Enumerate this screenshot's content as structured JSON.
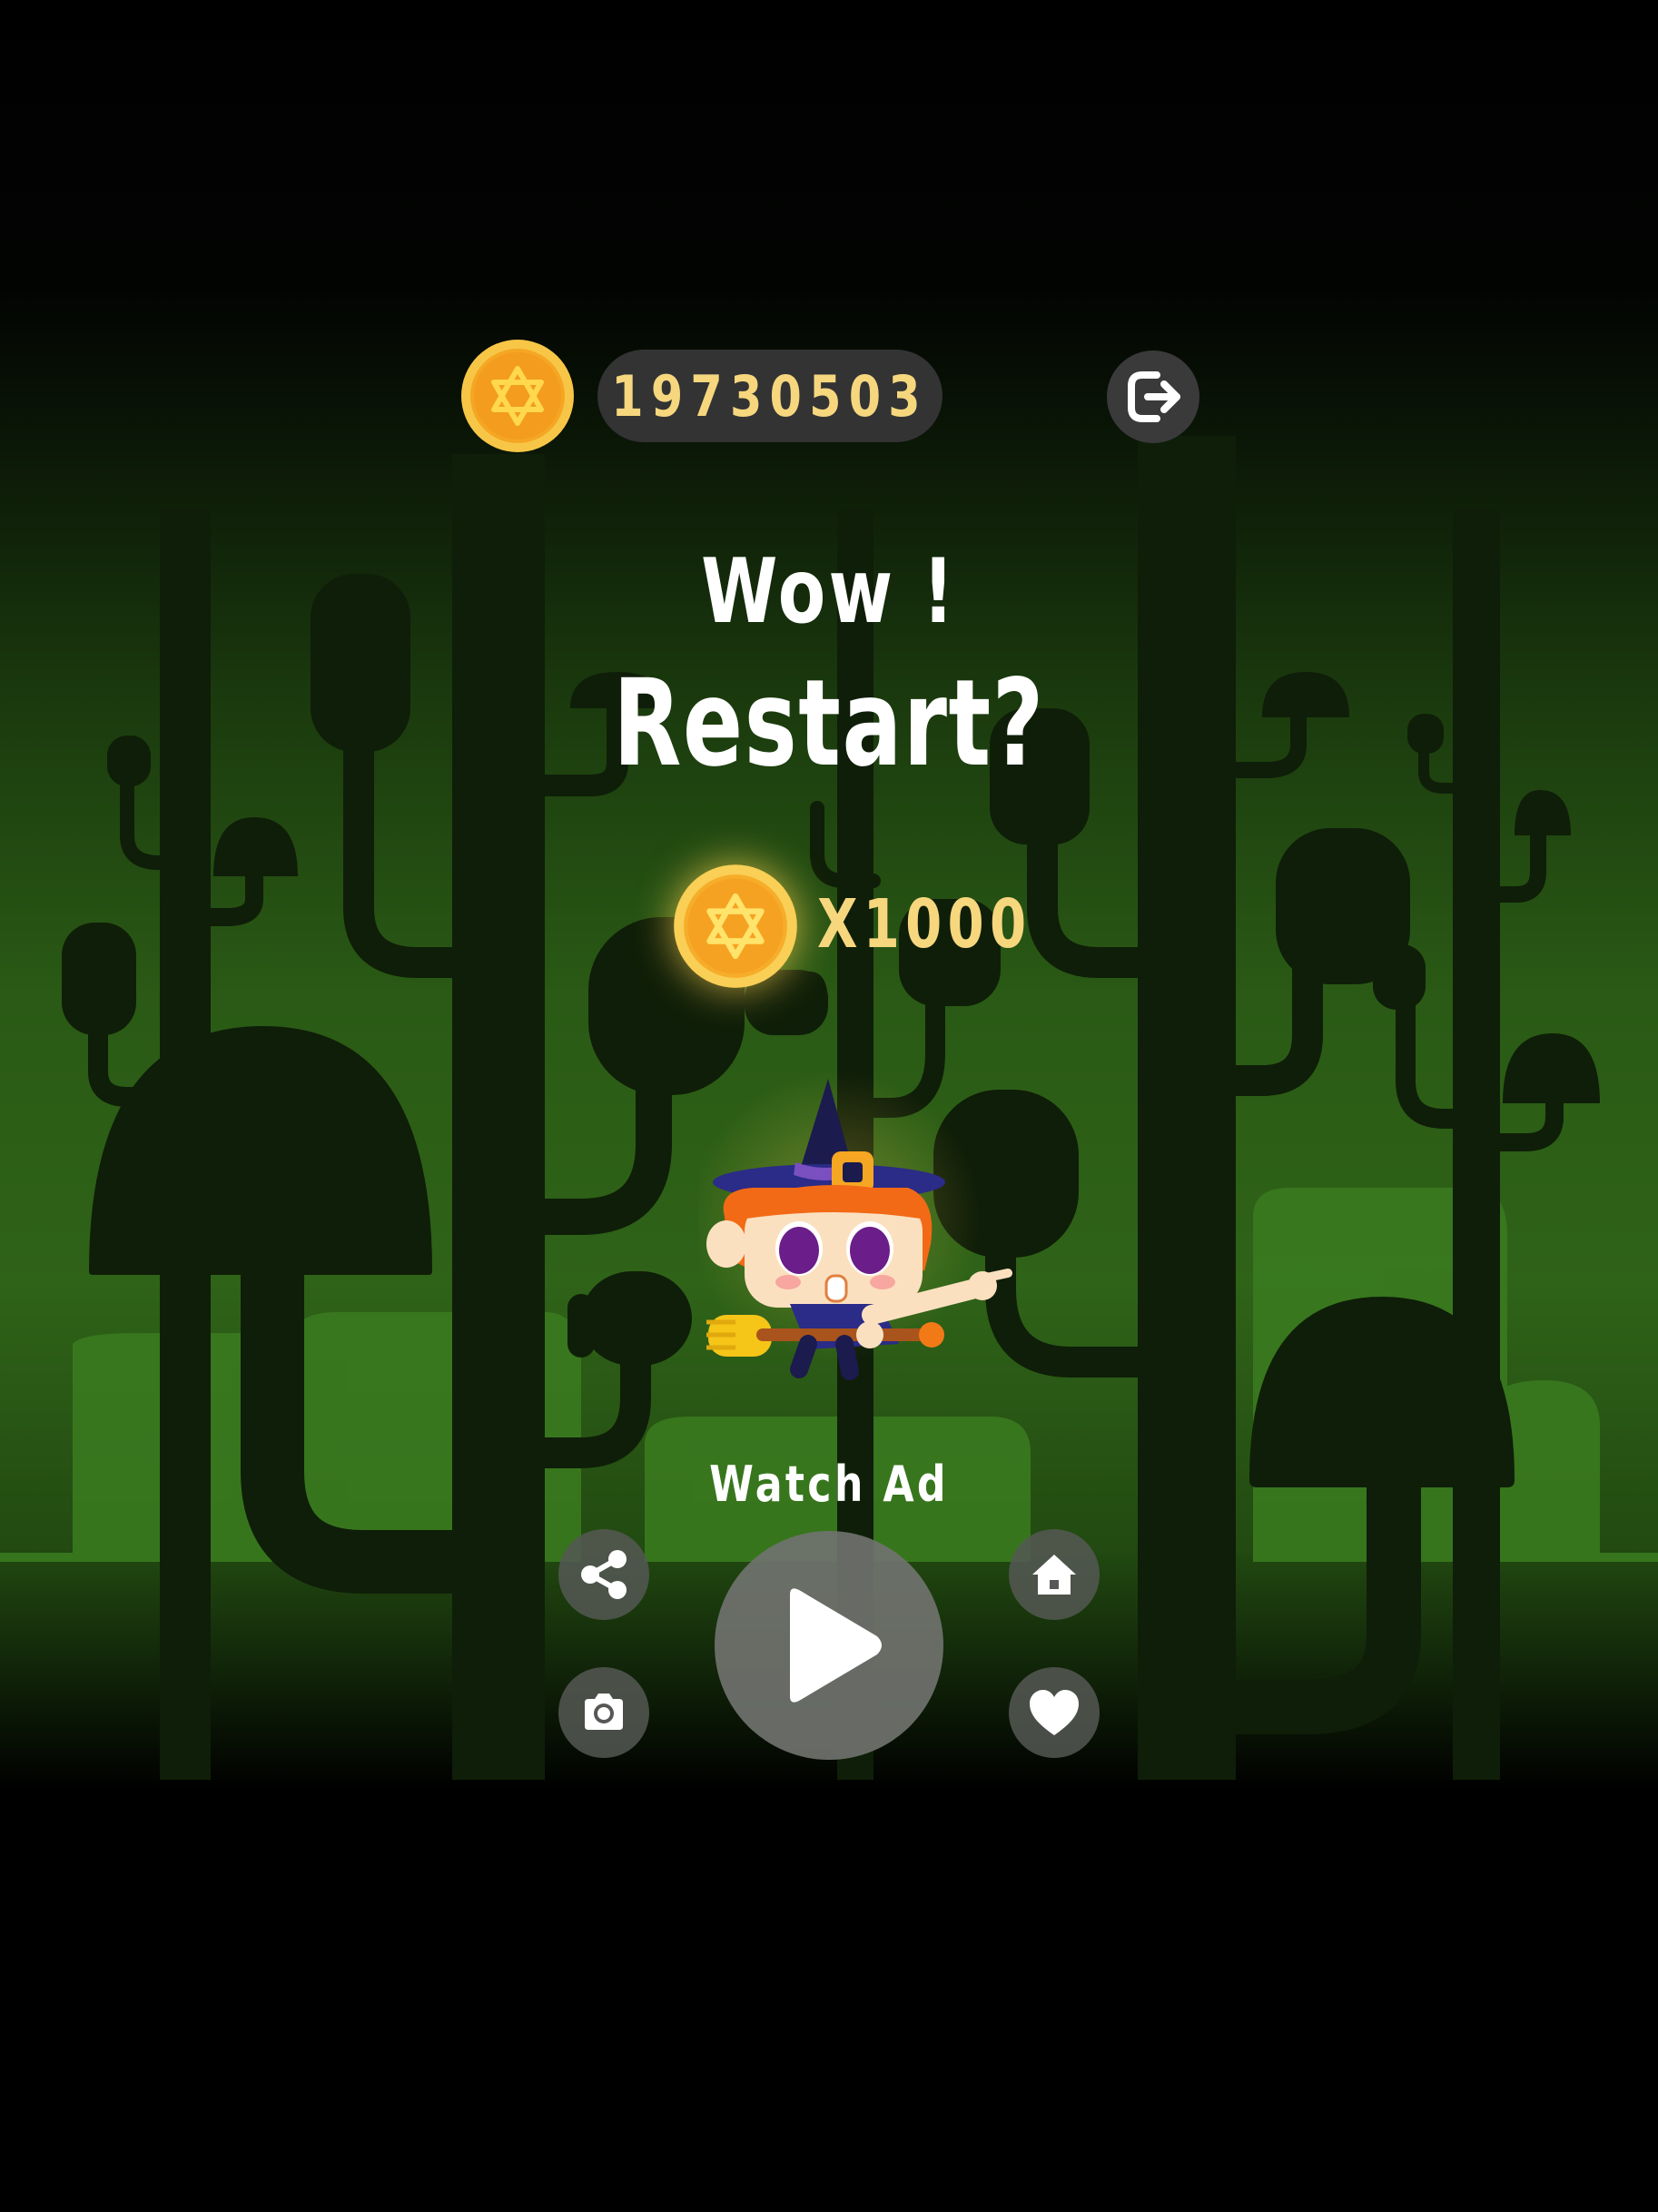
{
  "hud": {
    "coin_icon": "star-of-david-coin-icon",
    "score": "19730503",
    "exit_icon": "exit-icon"
  },
  "headline": {
    "line1": "Wow !",
    "line2": "Restart?"
  },
  "reward": {
    "coin_icon": "star-of-david-coin-icon",
    "amount": "X1000"
  },
  "character": {
    "icon": "witch-on-broom-icon"
  },
  "actions": {
    "watch_label": "Watch Ad",
    "share_icon": "share-icon",
    "camera_icon": "camera-icon",
    "play_icon": "play-icon",
    "home_icon": "home-icon",
    "like_icon": "heart-icon"
  },
  "colors": {
    "coin_gold": "#f7b52c",
    "score_text": "#f6d77e",
    "forest_green": "#3c7a1e",
    "silhouette": "#0f1e08"
  }
}
